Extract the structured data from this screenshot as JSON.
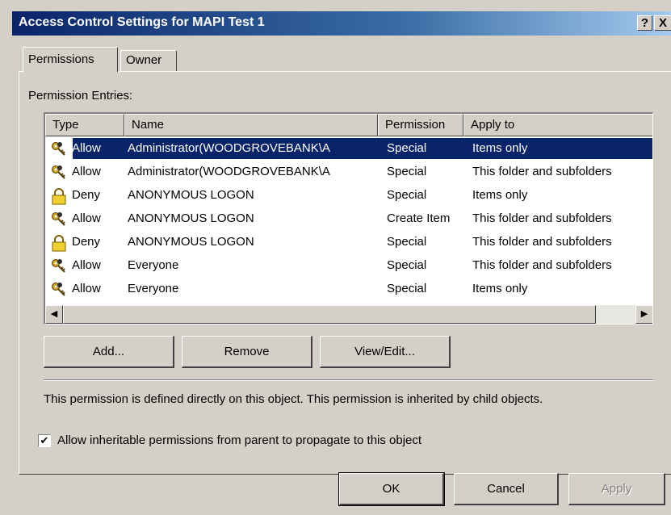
{
  "window": {
    "title": "Access Control Settings for MAPI Test 1",
    "help_label": "?",
    "close_label": "X"
  },
  "tabs": [
    {
      "label": "Permissions",
      "active": true
    },
    {
      "label": "Owner",
      "active": false
    }
  ],
  "permissions": {
    "entries_label": "Permission Entries:",
    "columns": [
      "Type",
      "Name",
      "Permission",
      "Apply to"
    ],
    "rows": [
      {
        "type": "Allow",
        "name": "Administrator(WOODGROVEBANK\\A",
        "permission": "Special",
        "apply_to": "Items only",
        "icon": "key-icon",
        "selected": true
      },
      {
        "type": "Allow",
        "name": "Administrator(WOODGROVEBANK\\A",
        "permission": "Special",
        "apply_to": "This folder and subfolders",
        "icon": "key-icon",
        "selected": false
      },
      {
        "type": "Deny",
        "name": "ANONYMOUS LOGON",
        "permission": "Special",
        "apply_to": "Items only",
        "icon": "lock-icon",
        "selected": false
      },
      {
        "type": "Allow",
        "name": "ANONYMOUS LOGON",
        "permission": "Create Item",
        "apply_to": "This folder and subfolders",
        "icon": "key-icon",
        "selected": false
      },
      {
        "type": "Deny",
        "name": "ANONYMOUS LOGON",
        "permission": "Special",
        "apply_to": "This folder and subfolders",
        "icon": "lock-icon",
        "selected": false
      },
      {
        "type": "Allow",
        "name": "Everyone",
        "permission": "Special",
        "apply_to": "This folder and subfolders",
        "icon": "key-icon",
        "selected": false
      },
      {
        "type": "Allow",
        "name": "Everyone",
        "permission": "Special",
        "apply_to": "Items only",
        "icon": "key-icon",
        "selected": false
      }
    ],
    "scroll_left": "◀",
    "scroll_right": "▶"
  },
  "buttons": {
    "add": "Add...",
    "remove": "Remove",
    "view_edit": "View/Edit...",
    "ok": "OK",
    "cancel": "Cancel",
    "apply": "Apply"
  },
  "info_text": "This permission is defined directly on this object. This permission is inherited by child objects.",
  "inherit_checkbox": {
    "label": "Allow inheritable permissions from parent to propagate to this object",
    "checked": true,
    "mark": "✔"
  },
  "colors": {
    "title_bar": "#0a246a",
    "selection": "#0a246a",
    "dialog_bg": "#d4d0c8"
  }
}
